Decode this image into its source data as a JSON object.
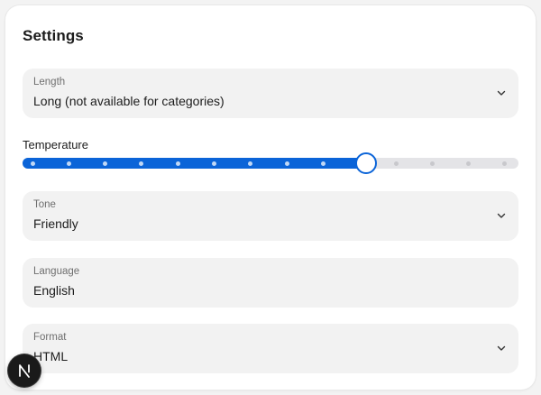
{
  "title": "Settings",
  "fields": {
    "length": {
      "label": "Length",
      "value": "Long (not available for categories)",
      "icon": "chevron-down-icon"
    },
    "tone": {
      "label": "Tone",
      "value": "Friendly",
      "icon": "chevron-down-icon"
    },
    "language": {
      "label": "Language",
      "value": "English"
    },
    "format": {
      "label": "Format",
      "value": "HTML",
      "icon": "chevron-down-icon"
    }
  },
  "temperature": {
    "label": "Temperature",
    "steps": 14,
    "selected_step": 9,
    "level_fraction": 0.69,
    "accent_color": "#0b64d8"
  },
  "floating_button": {
    "icon": "n-logo-icon"
  }
}
